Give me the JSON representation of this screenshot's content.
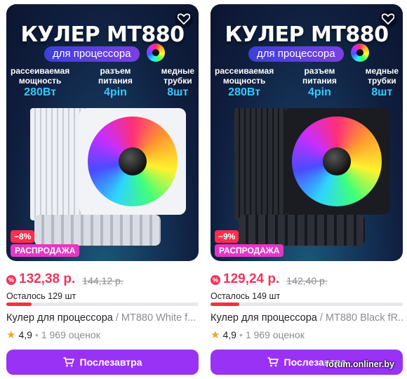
{
  "colors": {
    "price": "#f0345e",
    "button": "#9a32f5",
    "discount_badge": "#ff2e4f",
    "sale_badge": "#e536c7",
    "stock_bar": "#ee3344",
    "rating_star": "#f5a623",
    "promo_spec_value": "#36c8ff"
  },
  "promo": {
    "headline": "КУЛЕР МТ880",
    "subheadline": "для процессора",
    "specs": [
      {
        "label_line1": "рассеиваемая",
        "label_line2": "мощность",
        "value": "280Вт"
      },
      {
        "label_line1": "разъем",
        "label_line2": "питания",
        "value": "4pin"
      },
      {
        "label_line1": "медные",
        "label_line2": "трубки",
        "value": "8шт"
      }
    ]
  },
  "products": [
    {
      "variant": "white",
      "discount": "−8%",
      "sale_badge": "РАСПРОДАЖА",
      "price": "132,38 р.",
      "old_price": "144,12 р.",
      "stock_text": "Осталось 129 шт",
      "stock_level": 0.13,
      "title_main": "Кулер для процессора",
      "title_sub": " / МТ880 White f...",
      "rating": "4,9",
      "reviews": "1 969 оценок",
      "button_label": "Послезавтра"
    },
    {
      "variant": "black",
      "discount": "−9%",
      "sale_badge": "РАСПРОДАЖА",
      "price": "129,24 р.",
      "old_price": "142,40 р.",
      "stock_text": "Осталось 149 шт",
      "stock_level": 0.15,
      "title_main": "Кулер для процессора",
      "title_sub": " / МТ880 Black fR...",
      "rating": "4,9",
      "reviews": "1 969 оценок",
      "button_label": "Послезавтра"
    }
  ],
  "watermark": "forum.onliner.by"
}
